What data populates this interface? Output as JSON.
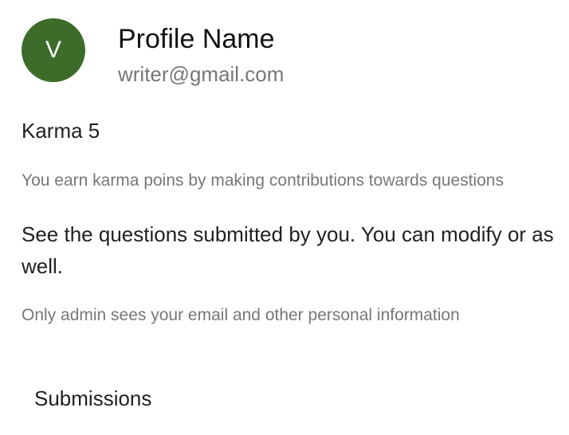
{
  "profile": {
    "avatar_initial": "V",
    "avatar_color": "#3d6b2a",
    "name": "Profile Name",
    "email": "writer@gmail.com"
  },
  "karma": {
    "text": "Karma 5",
    "note": "You earn karma poins by making contributions towards questions"
  },
  "submissions": {
    "info": "See the questions submitted by you. You can modify or as well.",
    "privacy_note": "Only admin sees your email and other personal information",
    "tab_label": "Submissions"
  }
}
